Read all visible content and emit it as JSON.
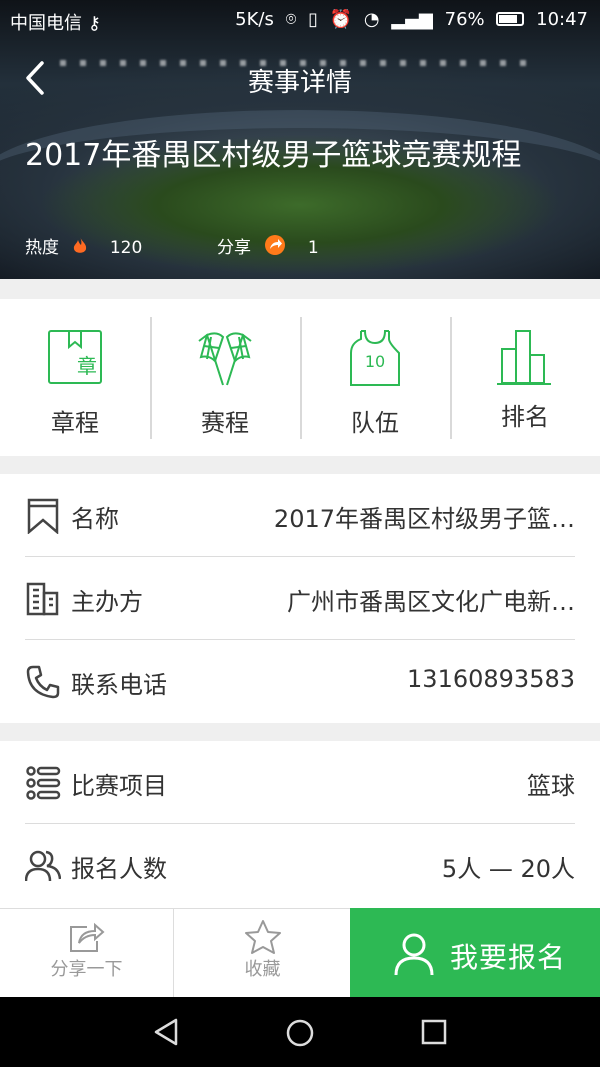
{
  "status_bar": {
    "carrier": "中国电信",
    "speed": "5K/s",
    "battery": "76%",
    "time": "10:47"
  },
  "nav": {
    "title": "赛事详情"
  },
  "event": {
    "title": "2017年番禺区村级男子篮球竞赛规程",
    "heat_label": "热度",
    "heat_value": "120",
    "share_label": "分享",
    "share_value": "1"
  },
  "tiles": [
    {
      "label": "章程",
      "icon": "rules-book-icon",
      "glyph": "章"
    },
    {
      "label": "赛程",
      "icon": "checkered-flags-icon"
    },
    {
      "label": "队伍",
      "icon": "jersey-icon",
      "glyph": "10"
    },
    {
      "label": "排名",
      "icon": "bar-ranking-icon"
    }
  ],
  "info": [
    {
      "key": "名称",
      "value": "2017年番禺区村级男子篮…",
      "icon": "bookmark-icon"
    },
    {
      "key": "主办方",
      "value": "广州市番禺区文化广电新…",
      "icon": "building-icon"
    },
    {
      "key": "联系电话",
      "value": "13160893583",
      "icon": "phone-icon"
    }
  ],
  "details": [
    {
      "key": "比赛项目",
      "value": "篮球",
      "icon": "list-icon"
    },
    {
      "key": "报名人数",
      "value": "5人 — 20人",
      "icon": "users-icon"
    }
  ],
  "bottom_bar": {
    "share": "分享一下",
    "favorite": "收藏",
    "signup": "我要报名"
  },
  "colors": {
    "accent": "#2db954"
  }
}
